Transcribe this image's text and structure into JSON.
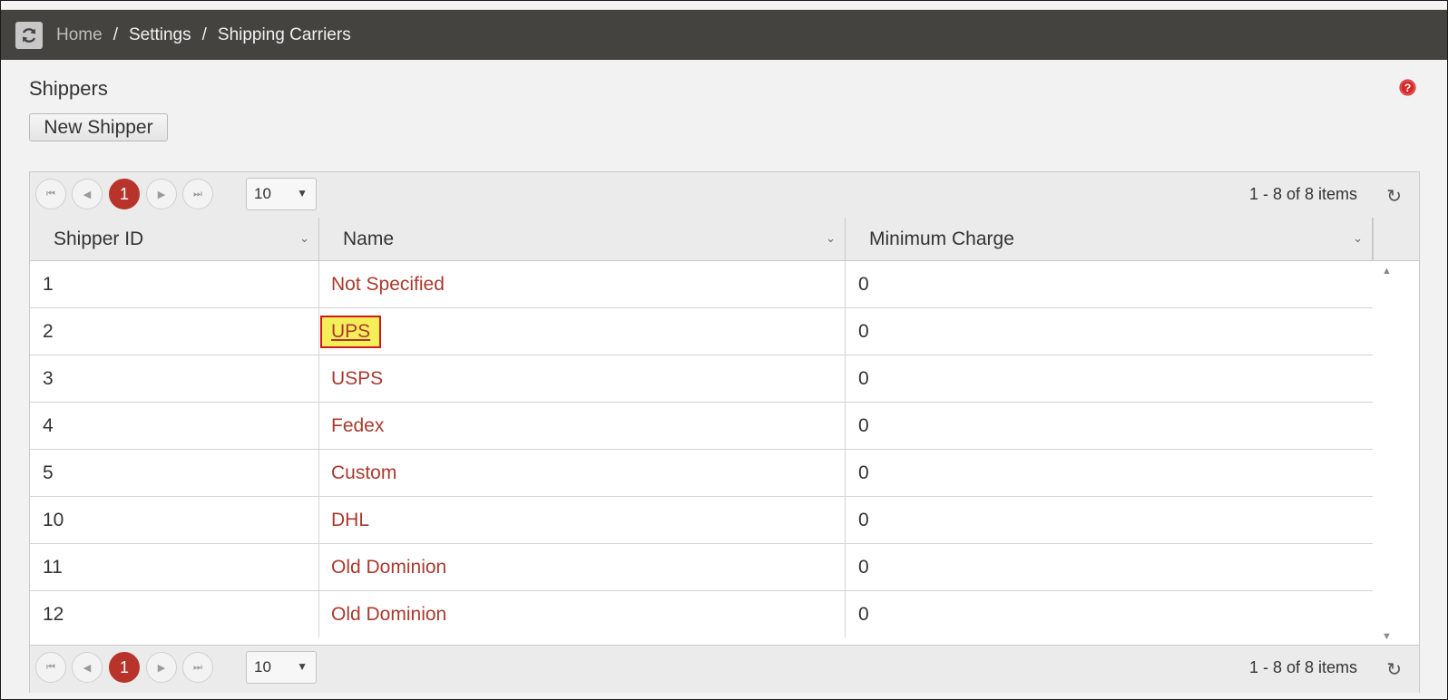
{
  "breadcrumb": {
    "home": "Home",
    "settings": "Settings",
    "current": "Shipping Carriers",
    "sep": "/"
  },
  "page": {
    "title": "Shippers",
    "new_button": "New Shipper"
  },
  "pager": {
    "current_page": "1",
    "page_size": "10",
    "info": "1 - 8 of 8 items",
    "first": "⏮",
    "prev": "◀",
    "next": "▶",
    "last": "⏭",
    "size_caret": "▼",
    "reload": "↻"
  },
  "table": {
    "columns": [
      {
        "label": "Shipper ID"
      },
      {
        "label": "Name"
      },
      {
        "label": "Minimum Charge"
      }
    ],
    "rows": [
      {
        "id": "1",
        "name": "Not Specified",
        "min_charge": "0"
      },
      {
        "id": "2",
        "name": "UPS",
        "min_charge": "0"
      },
      {
        "id": "3",
        "name": "USPS",
        "min_charge": "0"
      },
      {
        "id": "4",
        "name": "Fedex",
        "min_charge": "0"
      },
      {
        "id": "5",
        "name": "Custom",
        "min_charge": "0"
      },
      {
        "id": "10",
        "name": "DHL",
        "min_charge": "0"
      },
      {
        "id": "11",
        "name": "Old Dominion",
        "min_charge": "0"
      },
      {
        "id": "12",
        "name": "Old Dominion",
        "min_charge": "0"
      }
    ],
    "highlighted_row_index": 1
  },
  "colors": {
    "header_bg": "#444340",
    "link": "#a93a2f",
    "accent": "#b8342a",
    "highlight": "#f4ee58",
    "highlight_border": "#d21a1a"
  },
  "icons": {
    "refresh": "refresh-icon",
    "help": "help-icon"
  }
}
